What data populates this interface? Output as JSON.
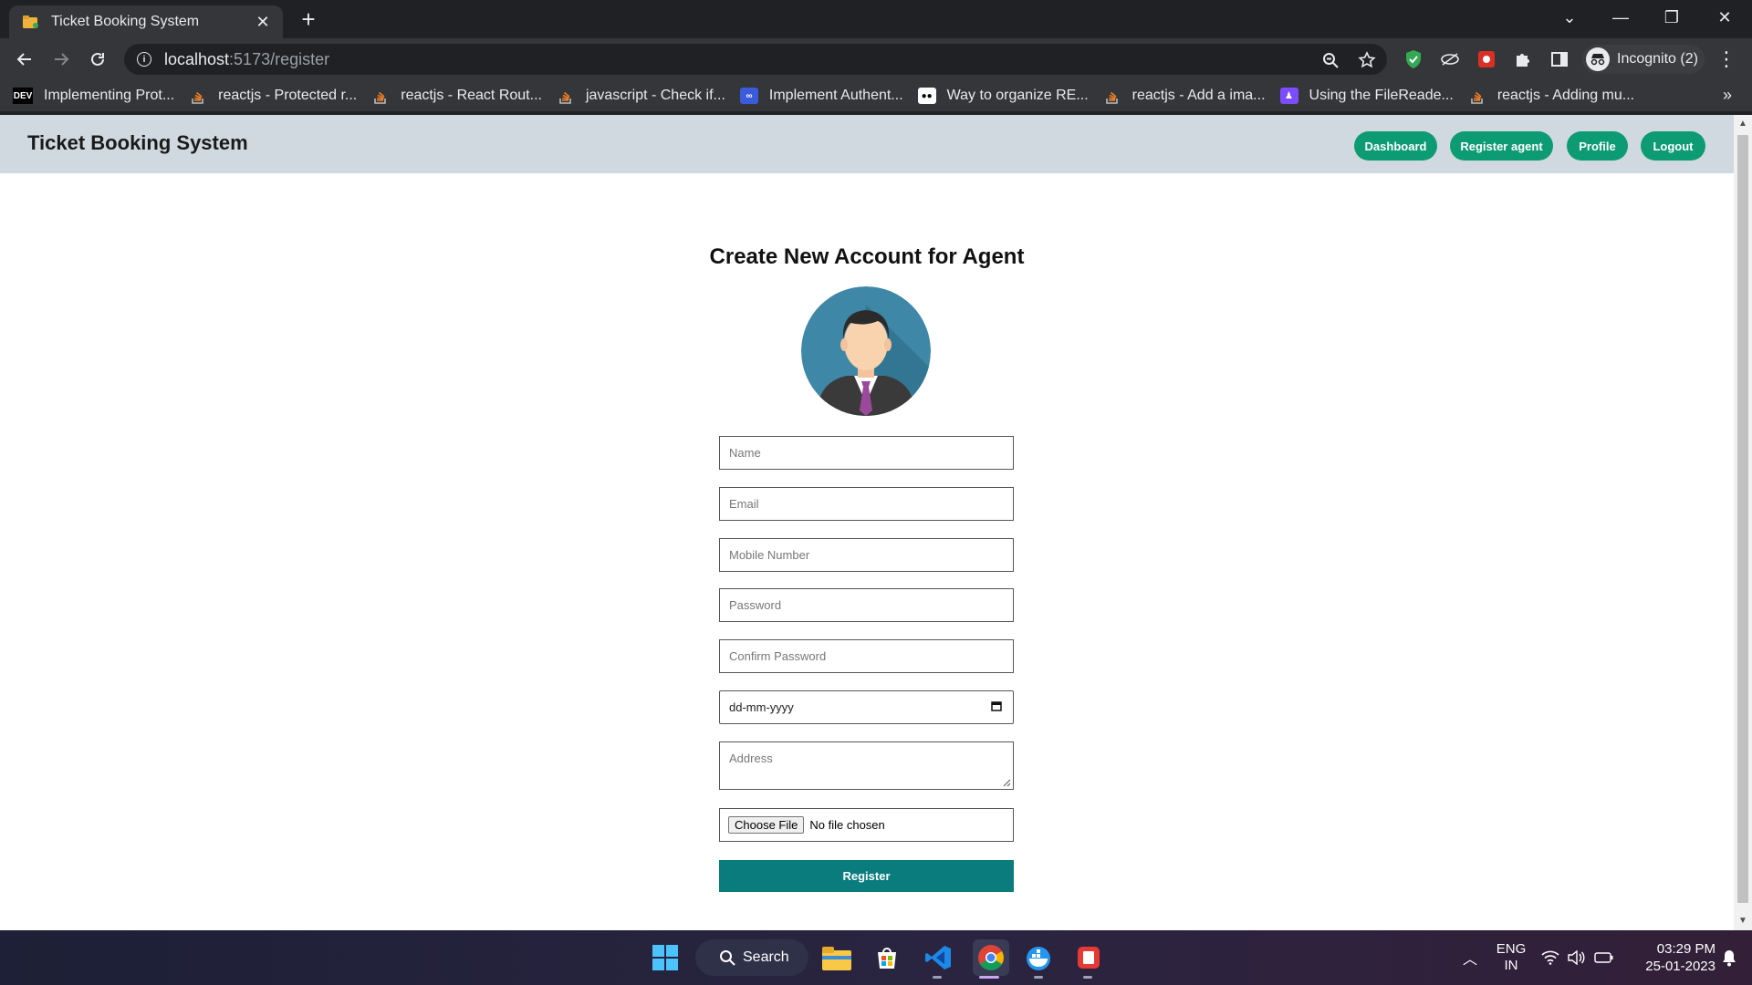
{
  "browser": {
    "tab_title": "Ticket Booking System",
    "tab_close": "✕",
    "new_tab": "+",
    "url_host": "localhost",
    "url_path": ":5173/register",
    "incognito_label": "Incognito (2)",
    "window_controls": {
      "dropdown": "⌄",
      "minimize": "—",
      "restore": "❐",
      "close": "✕"
    },
    "bookmarks": [
      {
        "label": "Implementing Prot...",
        "icon": "dev-icon"
      },
      {
        "label": "reactjs - Protected r...",
        "icon": "stackoverflow-icon"
      },
      {
        "label": "reactjs - React Rout...",
        "icon": "stackoverflow-icon"
      },
      {
        "label": "javascript - Check if...",
        "icon": "stackoverflow-icon"
      },
      {
        "label": "Implement Authent...",
        "icon": "codedamn-icon"
      },
      {
        "label": "Way to organize RE...",
        "icon": "medium-icon"
      },
      {
        "label": "reactjs - Add a ima...",
        "icon": "stackoverflow-icon"
      },
      {
        "label": "Using the FileReade...",
        "icon": "bookmark-purple-icon"
      },
      {
        "label": "reactjs - Adding mu...",
        "icon": "stackoverflow-icon"
      }
    ],
    "bookmarks_more": "»"
  },
  "app": {
    "brand": "Ticket Booking System",
    "nav": [
      "Dashboard",
      "Register agent",
      "Profile",
      "Logout"
    ],
    "accent": "#0d9b74",
    "navbar_bg": "#cfd9df"
  },
  "form": {
    "title": "Create New Account for Agent",
    "placeholders": {
      "name": "Name",
      "email": "Email",
      "mobile": "Mobile Number",
      "password": "Password",
      "confirm_password": "Confirm Password",
      "address": "Address"
    },
    "date_value": "dd-mm-yyyy",
    "file_button": "Choose File",
    "file_status": "No file chosen",
    "submit": "Register",
    "submit_color": "#0a7c7e"
  },
  "taskbar": {
    "search_label": "Search",
    "lang_line1": "ENG",
    "lang_line2": "IN",
    "time": "03:29 PM",
    "date": "25-01-2023"
  }
}
